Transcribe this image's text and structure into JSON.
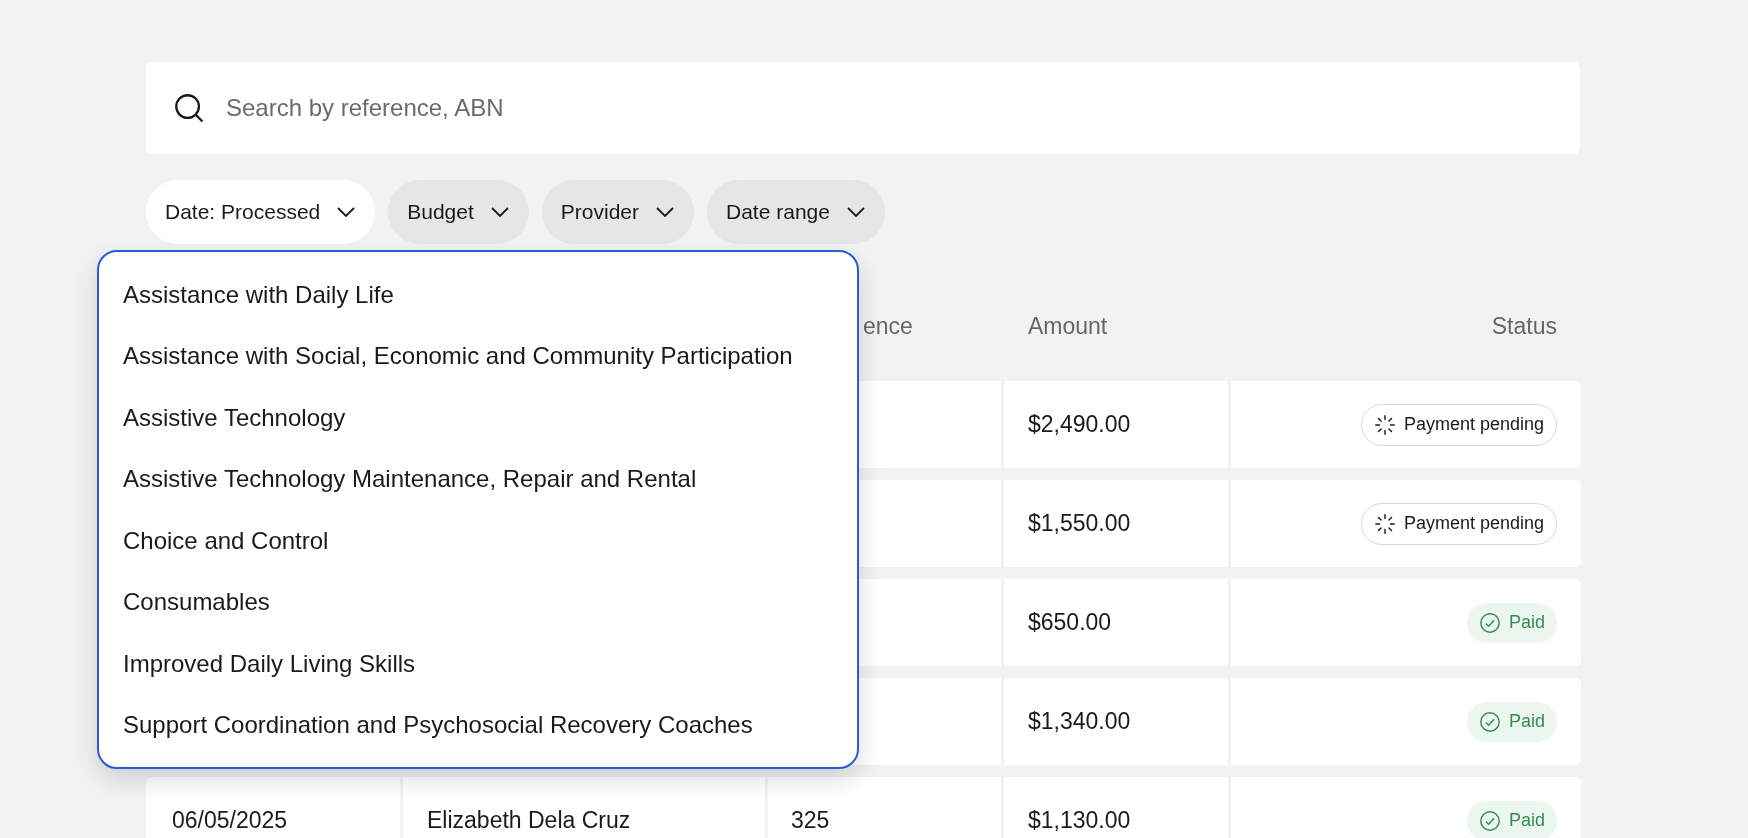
{
  "search": {
    "placeholder": "Search by reference, ABN"
  },
  "filters": [
    {
      "label": "Date: Processed",
      "selected": true
    },
    {
      "label": "Budget",
      "selected": false
    },
    {
      "label": "Provider",
      "selected": false
    },
    {
      "label": "Date range",
      "selected": false
    }
  ],
  "dropdown": {
    "options": [
      "Assistance with Daily Life",
      "Assistance with Social, Economic and Community Participation",
      "Assistive Technology",
      "Assistive Technology Maintenance, Repair and Rental",
      "Choice and Control",
      "Consumables",
      "Improved Daily Living Skills",
      "Support Coordination and Psychosocial Recovery Coaches"
    ]
  },
  "table": {
    "columns": [
      null,
      null,
      "ence",
      "Amount",
      "Status"
    ],
    "rows": [
      {
        "cells": [
          null,
          null,
          null,
          "$2,490.00"
        ],
        "status": {
          "kind": "pending",
          "label": "Payment pending"
        }
      },
      {
        "cells": [
          null,
          null,
          null,
          "$1,550.00"
        ],
        "status": {
          "kind": "pending",
          "label": "Payment pending"
        }
      },
      {
        "cells": [
          null,
          null,
          null,
          "$650.00"
        ],
        "status": {
          "kind": "paid",
          "label": "Paid"
        }
      },
      {
        "cells": [
          null,
          null,
          null,
          "$1,340.00"
        ],
        "status": {
          "kind": "paid",
          "label": "Paid"
        }
      },
      {
        "cells": [
          "06/05/2025",
          "Elizabeth Dela Cruz",
          "325",
          "$1,130.00"
        ],
        "status": {
          "kind": "paid",
          "label": "Paid"
        }
      }
    ]
  }
}
